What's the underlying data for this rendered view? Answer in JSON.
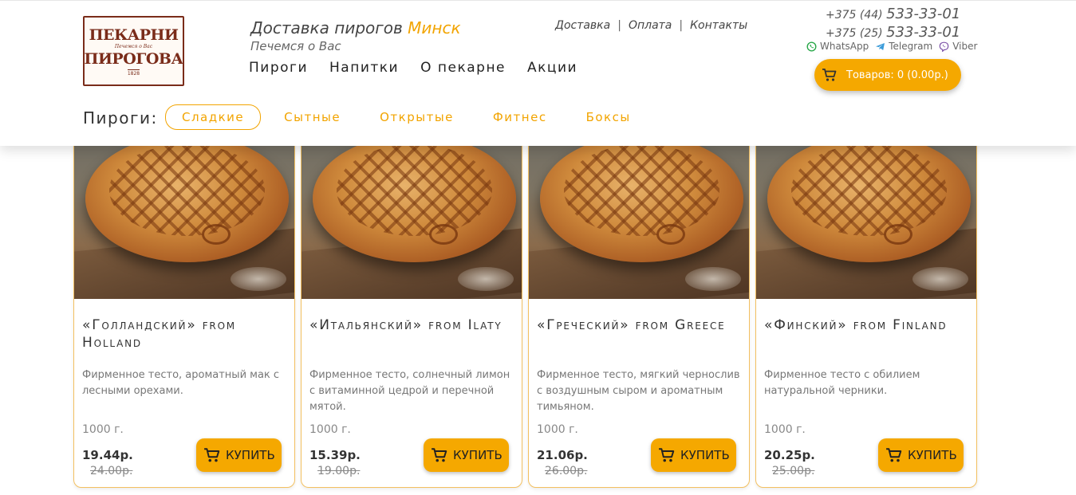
{
  "header": {
    "logo": {
      "line1": "ПЕКАРНИ",
      "line2": "ПИРОГОВА",
      "tagline": "Печемся о Вас",
      "year": "1828"
    },
    "slogan": "Доставка пирогов ",
    "city": "Минск",
    "subslogan": "Печемся о Вас",
    "main_nav": [
      "Пироги",
      "Напитки",
      "О пекарне",
      "Акции"
    ],
    "top_nav": [
      "Доставка",
      "Оплата",
      "Контакты"
    ],
    "phones": [
      {
        "prefix": "+375 (44) ",
        "number": "533-33-01"
      },
      {
        "prefix": "+375 (25) ",
        "number": "533-33-01"
      }
    ],
    "messengers": [
      "WhatsApp",
      "Telegram",
      "Viber"
    ],
    "cart_label": "Товаров: 0 (0.00р.)",
    "categories_label": "Пироги:",
    "categories": [
      "Сладкие",
      "Сытные",
      "Открытые",
      "Фитнес",
      "Боксы"
    ],
    "active_category": "Сладкие"
  },
  "products": [
    {
      "title": "«Голландский» from Holland",
      "description": "Фирменное тесто, ароматный мак с лесными орехами.",
      "weight": "1000 г.",
      "price": "19.44р.",
      "old_price": "24.00р.",
      "buy_label": "КУПИТЬ"
    },
    {
      "title": "«Итальянский» from Ilaty",
      "description": "Фирменное тесто, солнечный лимон с витаминной цедрой и перечной мятой.",
      "weight": "1000 г.",
      "price": "15.39р.",
      "old_price": "19.00р.",
      "buy_label": "КУПИТЬ"
    },
    {
      "title": "«Греческий» from Greece",
      "description": "Фирменное тесто, мягкий чернослив с воздушным сыром и ароматным тимьяном.",
      "weight": "1000 г.",
      "price": "21.06р.",
      "old_price": "26.00р.",
      "buy_label": "КУПИТЬ"
    },
    {
      "title": "«Финский» from Finland",
      "description": "Фирменное тесто с обилием натуральной черники.",
      "weight": "1000 г.",
      "price": "20.25р.",
      "old_price": "25.00р.",
      "buy_label": "КУПИТЬ"
    }
  ],
  "colors": {
    "accent": "#f5a800",
    "brand": "#7a2c1a",
    "text": "#333333"
  },
  "icons": {
    "cart": "cart-icon",
    "whatsapp": "whatsapp-icon",
    "telegram": "telegram-icon",
    "viber": "viber-icon"
  }
}
